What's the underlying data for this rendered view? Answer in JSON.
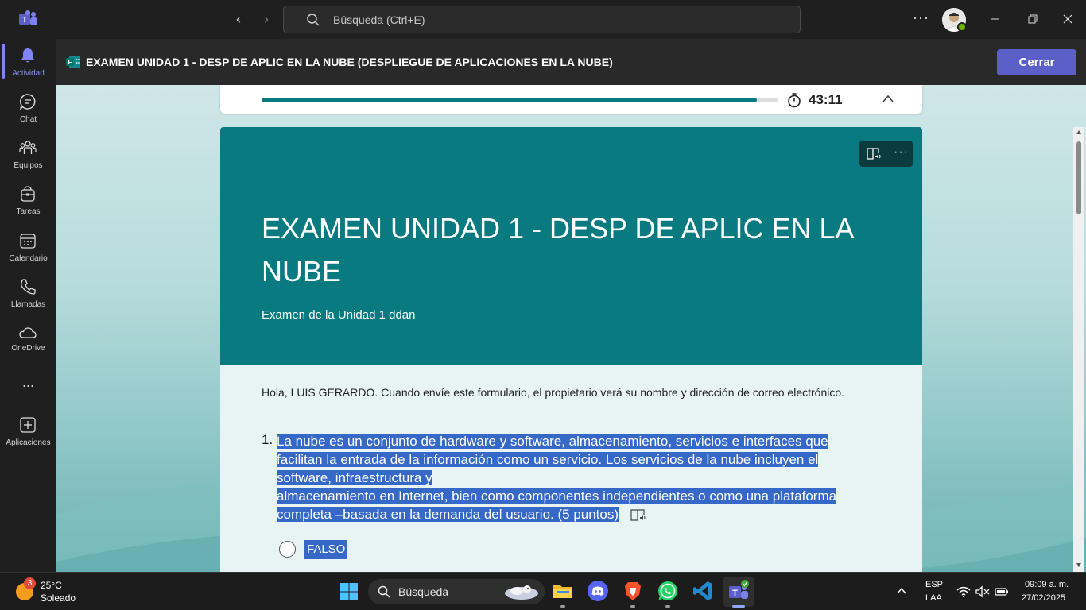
{
  "titlebar": {
    "search_placeholder": "Búsqueda (Ctrl+E)"
  },
  "rail": {
    "items": [
      {
        "label": "Actividad",
        "icon": "bell-icon"
      },
      {
        "label": "Chat",
        "icon": "chat-icon"
      },
      {
        "label": "Equipos",
        "icon": "teams-icon"
      },
      {
        "label": "Tareas",
        "icon": "tasks-icon"
      },
      {
        "label": "Calendario",
        "icon": "calendar-icon"
      },
      {
        "label": "Llamadas",
        "icon": "phone-icon"
      },
      {
        "label": "OneDrive",
        "icon": "cloud-icon"
      },
      {
        "label": "...",
        "icon": "more-icon"
      },
      {
        "label": "Aplicaciones",
        "icon": "add-apps-icon"
      }
    ]
  },
  "apphead": {
    "title": "EXAMEN UNIDAD 1 - DESP DE APLIC EN LA NUBE (DESPLIEGUE DE APLICACIONES EN LA NUBE)",
    "close_label": "Cerrar"
  },
  "progress": {
    "fraction": 0.96,
    "timer": "43:11"
  },
  "form": {
    "title": "EXAMEN UNIDAD 1 - DESP DE APLIC EN LA NUBE",
    "subtitle": "Examen de la Unidad 1 ddan",
    "greeting": "Hola, LUIS GERARDO. Cuando envíe este formulario, el propietario verá su nombre y dirección de correo electrónico.",
    "question": {
      "number": "1.",
      "lines": [
        "La nube  es un conjunto de hardware y software, almacenamiento, servicios e interfaces que",
        "facilitan la entrada de la información como un servicio. Los servicios de la nube incluyen el",
        "software, infraestructura y",
        "almacenamiento en Internet, bien como componentes independientes o como una plataforma",
        "completa –basada en la demanda del usuario."
      ],
      "points": "(5 puntos)",
      "options": [
        "FALSO"
      ]
    }
  },
  "taskbar": {
    "weather_badge": "3",
    "weather_temp": "25°C",
    "weather_desc": "Soleado",
    "search_label": "Búsqueda",
    "lang_top": "ESP",
    "lang_bottom": "LAA",
    "time": "09:09 a. m.",
    "date": "27/02/2025"
  },
  "colors": {
    "accent": "#5b5fc7",
    "form_teal": "#097a7f",
    "selection": "#3568c7"
  }
}
